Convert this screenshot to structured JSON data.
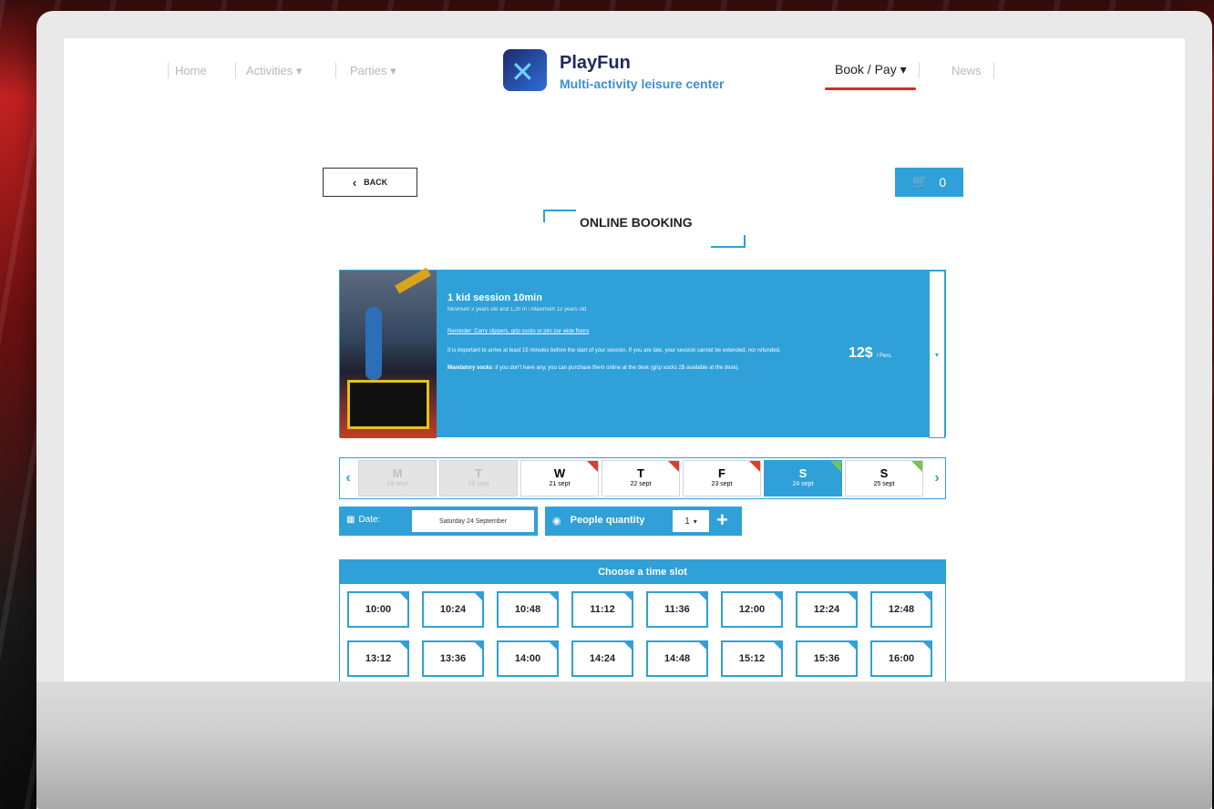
{
  "nav": {
    "home": "Home",
    "activities": "Activities",
    "parties": "Parties",
    "book_pay": "Book / Pay",
    "news": "News",
    "dropdown_glyph": "▾"
  },
  "brand": {
    "name": "PlayFun",
    "tagline": "Multi-activity leisure center",
    "logo_glyph": "✕"
  },
  "toolbar": {
    "back_label": "BACK",
    "back_icon": "‹",
    "cart_icon": "🛒",
    "cart_count": "0"
  },
  "page_title": "ONLINE BOOKING",
  "session": {
    "title": "1 kid session 10min",
    "subtitle": "Minimum 2 years old and 1,20 m / Maximum 12 years old",
    "link": "Reminder: Carry slippers, grip socks or join our wide floors",
    "para1": "It is important to arrive at least 15 minutes before the start of your session. If you are late, your session cannot be extended, nor refunded.",
    "para2_bold": "Mandatory socks",
    "para2": ": if you don't have any, you can purchase them online at the desk (grip socks 2$ available at the desk).",
    "price": "12$",
    "price_unit": "/ Pers.",
    "select_glyph": "▾"
  },
  "days": {
    "prev": "‹",
    "next": "›",
    "items": [
      {
        "letter": "M",
        "date": "19 sept"
      },
      {
        "letter": "T",
        "date": "20 sept"
      },
      {
        "letter": "W",
        "date": "21 sept"
      },
      {
        "letter": "T",
        "date": "22 sept"
      },
      {
        "letter": "F",
        "date": "23 sept"
      },
      {
        "letter": "S",
        "date": "24 sept"
      },
      {
        "letter": "S",
        "date": "25 sept"
      }
    ]
  },
  "date_field": {
    "label": "Date:",
    "value": "Saturday 24 September",
    "icon": "▦"
  },
  "people": {
    "label": "People quantity",
    "icon": "◉",
    "value": "1",
    "select_glyph": "▾",
    "plus": "+"
  },
  "slots": {
    "title": "Choose a time slot",
    "times": [
      "10:00",
      "10:24",
      "10:48",
      "11:12",
      "11:36",
      "12:00",
      "12:24",
      "12:48",
      "13:12",
      "13:36",
      "14:00",
      "14:24",
      "14:48",
      "15:12",
      "15:36",
      "16:00"
    ]
  },
  "colors": {
    "accent": "#2fa0d8",
    "active_underline": "#e02626",
    "available_corner": "#78c256",
    "full_corner": "#e23a2c"
  }
}
